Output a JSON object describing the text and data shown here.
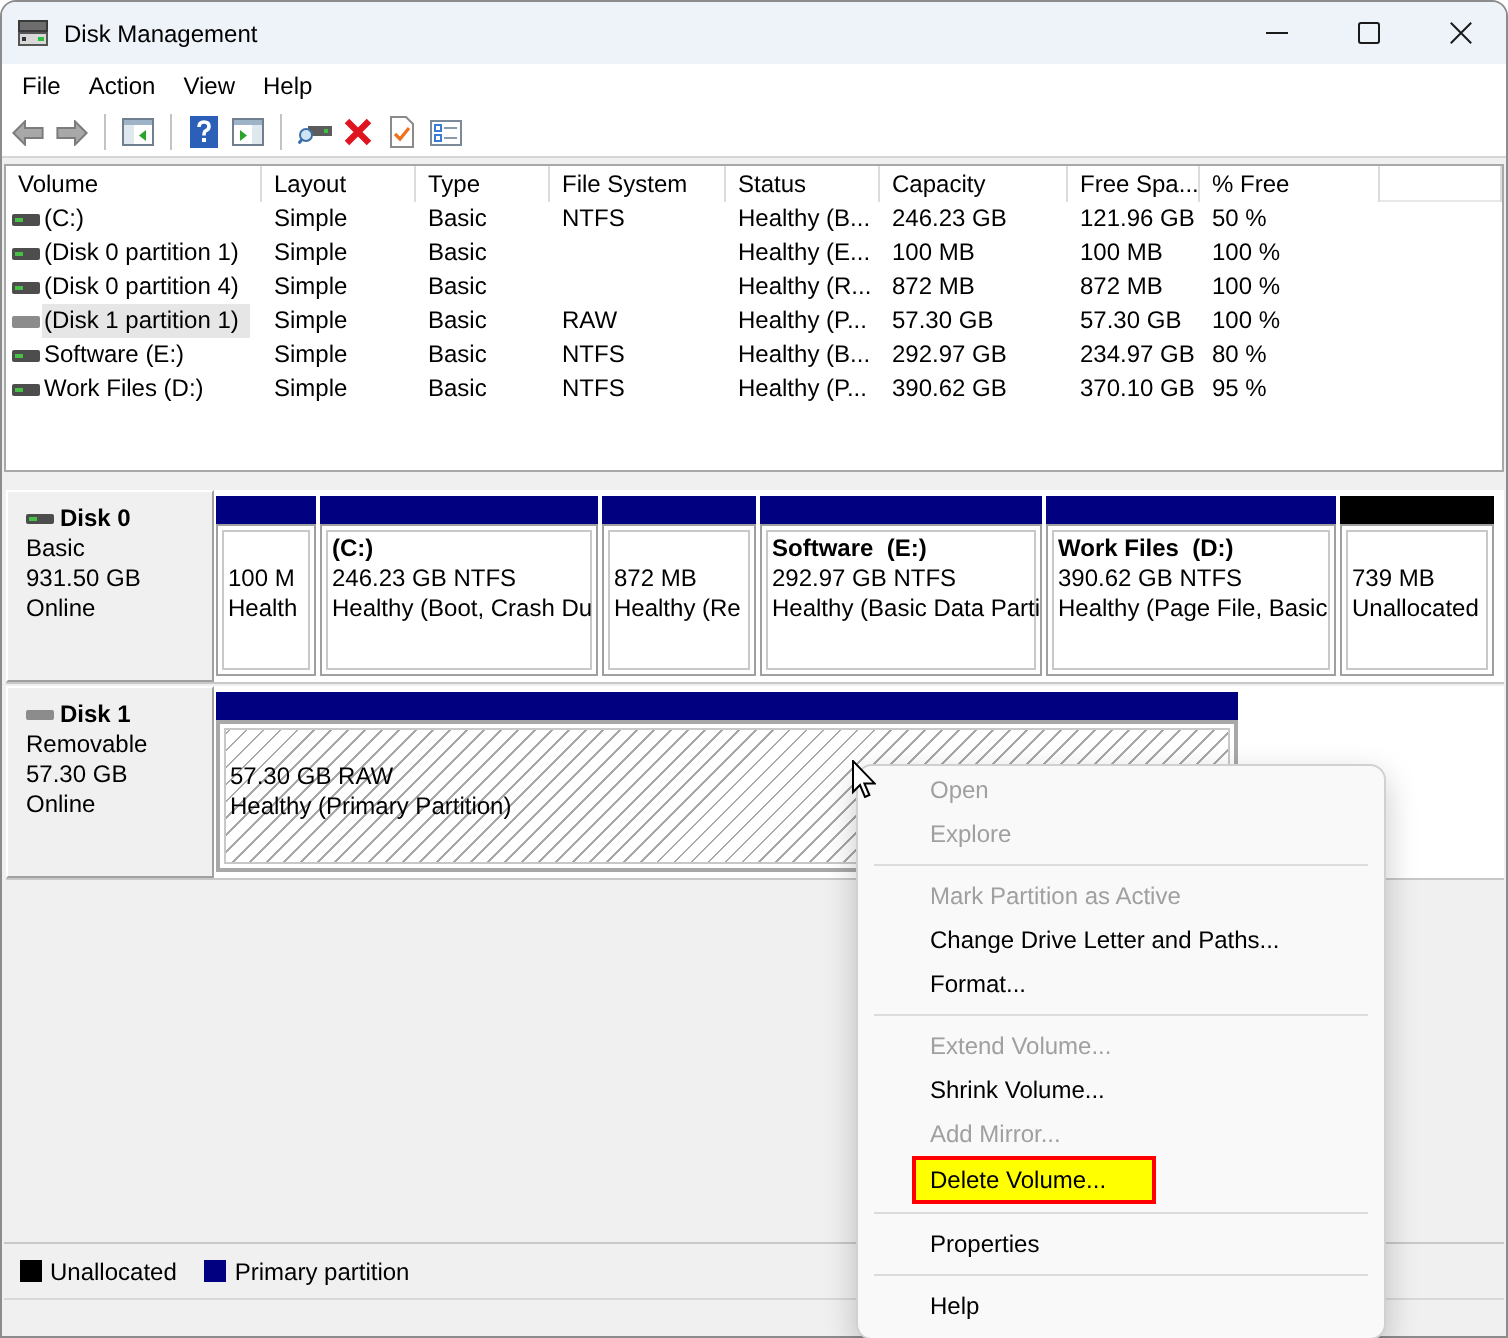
{
  "window": {
    "title": "Disk Management"
  },
  "menu_bar": [
    "File",
    "Action",
    "View",
    "Help"
  ],
  "volume_table": {
    "columns": [
      "Volume",
      "Layout",
      "Type",
      "File System",
      "Status",
      "Capacity",
      "Free Spa...",
      "% Free"
    ],
    "rows": [
      {
        "volume": "(C:)",
        "layout": "Simple",
        "type": "Basic",
        "file_system": "NTFS",
        "status": "Healthy (B...",
        "capacity": "246.23 GB",
        "free_space": "121.96 GB",
        "percent_free": "50 %",
        "selected": false,
        "removable": false
      },
      {
        "volume": "(Disk 0 partition 1)",
        "layout": "Simple",
        "type": "Basic",
        "status": "Healthy (E...",
        "capacity": "100 MB",
        "free_space": "100 MB",
        "percent_free": "100 %",
        "selected": false,
        "removable": false
      },
      {
        "volume": "(Disk 0 partition 4)",
        "layout": "Simple",
        "type": "Basic",
        "status": "Healthy (R...",
        "capacity": "872 MB",
        "free_space": "872 MB",
        "percent_free": "100 %",
        "selected": false,
        "removable": false
      },
      {
        "volume": "(Disk 1 partition 1)",
        "layout": "Simple",
        "type": "Basic",
        "file_system": "RAW",
        "status": "Healthy (P...",
        "capacity": "57.30 GB",
        "free_space": "57.30 GB",
        "percent_free": "100 %",
        "selected": true,
        "removable": true
      },
      {
        "volume": "Software (E:)",
        "layout": "Simple",
        "type": "Basic",
        "file_system": "NTFS",
        "status": "Healthy (B...",
        "capacity": "292.97 GB",
        "free_space": "234.97 GB",
        "percent_free": "80 %",
        "selected": false,
        "removable": false
      },
      {
        "volume": "Work Files (D:)",
        "layout": "Simple",
        "type": "Basic",
        "file_system": "NTFS",
        "status": "Healthy (P...",
        "capacity": "390.62 GB",
        "free_space": "370.10 GB",
        "percent_free": "95 %",
        "selected": false,
        "removable": false
      }
    ]
  },
  "disks": [
    {
      "name": "Disk 0",
      "type": "Basic",
      "size": "931.50 GB",
      "status": "Online",
      "removable": false,
      "partitions": [
        {
          "kind": "primary",
          "selected": false,
          "size": "100 M",
          "status": "Health"
        },
        {
          "kind": "primary",
          "selected": false,
          "label": "(C:)",
          "size": "246.23 GB NTFS",
          "status": "Healthy (Boot, Crash Du"
        },
        {
          "kind": "primary",
          "selected": false,
          "size": "872 MB",
          "status": "Healthy (Re"
        },
        {
          "kind": "primary",
          "selected": false,
          "label": "Software  (E:)",
          "size": "292.97 GB NTFS",
          "status": "Healthy (Basic Data Parti"
        },
        {
          "kind": "primary",
          "selected": false,
          "label": "Work Files  (D:)",
          "size": "390.62 GB NTFS",
          "status": "Healthy (Page File, Basic"
        },
        {
          "kind": "unallocated",
          "selected": false,
          "size": "739 MB",
          "status": "Unallocated"
        }
      ]
    },
    {
      "name": "Disk 1",
      "type": "Removable",
      "size": "57.30 GB",
      "status": "Online",
      "removable": true,
      "partitions": [
        {
          "kind": "primary",
          "selected": true,
          "size": "57.30 GB RAW",
          "status": "Healthy (Primary Partition)"
        }
      ]
    }
  ],
  "legend": [
    {
      "label": "Unallocated",
      "color": "#000000"
    },
    {
      "label": "Primary partition",
      "color": "#000080"
    }
  ],
  "context_menu": [
    {
      "kind": "item",
      "label": "Open",
      "disabled": true,
      "highlighted": false
    },
    {
      "kind": "item",
      "label": "Explore",
      "disabled": true,
      "highlighted": false
    },
    {
      "kind": "separator"
    },
    {
      "kind": "item",
      "label": "Mark Partition as Active",
      "disabled": true,
      "highlighted": false
    },
    {
      "kind": "item",
      "label": "Change Drive Letter and Paths...",
      "disabled": false,
      "highlighted": false
    },
    {
      "kind": "item",
      "label": "Format...",
      "disabled": false,
      "highlighted": false
    },
    {
      "kind": "separator"
    },
    {
      "kind": "item",
      "label": "Extend Volume...",
      "disabled": true,
      "highlighted": false
    },
    {
      "kind": "item",
      "label": "Shrink Volume...",
      "disabled": false,
      "highlighted": false
    },
    {
      "kind": "item",
      "label": "Add Mirror...",
      "disabled": true,
      "highlighted": false
    },
    {
      "kind": "item",
      "label": "Delete Volume...",
      "disabled": false,
      "highlighted": true
    },
    {
      "kind": "separator"
    },
    {
      "kind": "item",
      "label": "Properties",
      "disabled": false,
      "highlighted": false
    },
    {
      "kind": "separator"
    },
    {
      "kind": "item",
      "label": "Help",
      "disabled": false,
      "highlighted": false
    }
  ]
}
